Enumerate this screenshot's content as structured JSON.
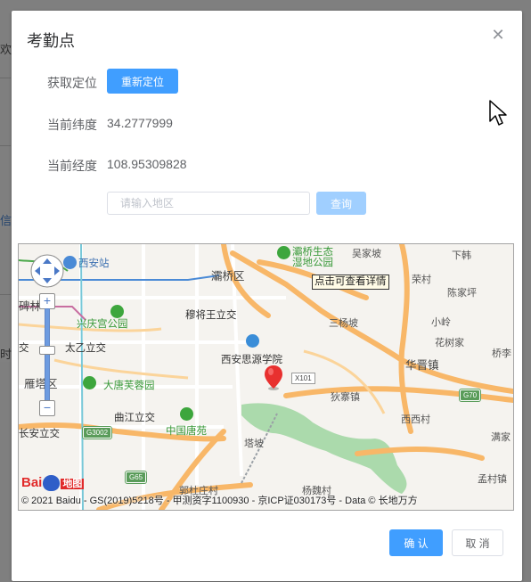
{
  "background": {
    "fragments": [
      "欢",
      "信",
      "时"
    ]
  },
  "dialog": {
    "title": "考勤点",
    "close_icon": "close-icon",
    "get_location": {
      "label": "获取定位",
      "button": "重新定位"
    },
    "latitude": {
      "label": "当前纬度",
      "value": "34.2777999"
    },
    "longitude": {
      "label": "当前经度",
      "value": "108.95309828"
    },
    "search": {
      "placeholder": "请输入地区",
      "value": "",
      "button": "查询"
    },
    "footer": {
      "confirm": "确 认",
      "cancel": "取 消"
    }
  },
  "map": {
    "tooltip": "点击可查看详情",
    "copyright": "© 2021 Baidu - GS(2019)5218号 - 甲测资字1100930 - 京ICP证030173号 - Data © 长地万方",
    "logo": {
      "text_left": "Bai",
      "text_right": "地图"
    },
    "controls": {
      "zoom_in": "+",
      "zoom_out": "−"
    },
    "labels": {
      "xian_station": "西安站",
      "baqiao_district": "灞桥区",
      "bahe_park": "灞桥生态",
      "bahe_park2": "湿地公园",
      "wujiapo": "吴家坡",
      "xiahan": "下韩",
      "ronghua": "荣村",
      "chenjiaping": "陈家坪",
      "xingqing_park": "兴庆宫公园",
      "jiangwang": "穆将王立交",
      "sanyipo": "三杨坡",
      "xiaoling": "小岭",
      "huashu": "花树家",
      "qiaoli": "桥李",
      "taiyi": "太乙立交",
      "siyuan": "西安思源学院",
      "huayan": "华晋镇",
      "yanta": "雁塔区",
      "furong": "大唐芙蓉园",
      "x101": "X101",
      "hujia": "狄寨镇",
      "g70": "G70",
      "qujiang": "曲江立交",
      "tangyuan": "中国唐苑",
      "xixi": "西西村",
      "chang_an": "长安立交",
      "g3002": "G3002",
      "tapo": "塔坡",
      "manjia": "满家",
      "mengzhuang": "孟村镇",
      "g65": "G65",
      "guodu": "郭杜庄村",
      "yangcun": "杨魏村",
      "jiao": "交",
      "beilin": "碑林"
    }
  }
}
